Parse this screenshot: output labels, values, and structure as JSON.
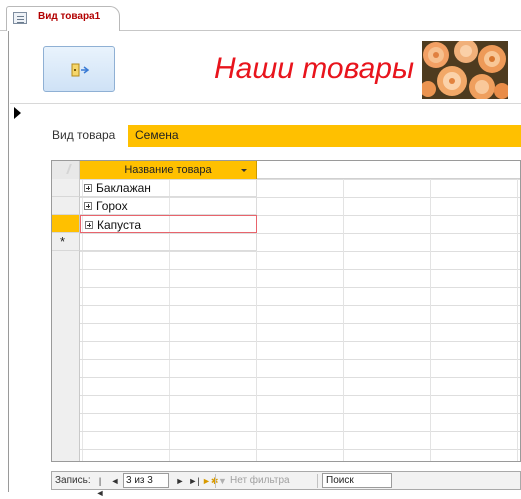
{
  "tab": {
    "label": "Вид товара1",
    "icon": "form-icon"
  },
  "form": {
    "title": "Наши товары",
    "exit_button_icon": "exit-icon",
    "image_icon": "flower-image",
    "field_label": "Вид товара",
    "field_value": "Семена"
  },
  "datasheet": {
    "column_header": "Название товара",
    "rows": [
      {
        "name": "Баклажан"
      },
      {
        "name": "Горох"
      },
      {
        "name": "Капуста"
      }
    ],
    "new_row_marker": "*"
  },
  "nav": {
    "label": "Запись:",
    "first": "|◄",
    "prev": "◄",
    "current": "3 из 3",
    "next": "►",
    "last": "►|",
    "new": "►✱",
    "filter_label": "Нет фильтра",
    "search_label": "Поиск"
  },
  "colors": {
    "accent": "#ffc000",
    "title_color": "#e8141c",
    "tab_label_color": "#b20000"
  }
}
